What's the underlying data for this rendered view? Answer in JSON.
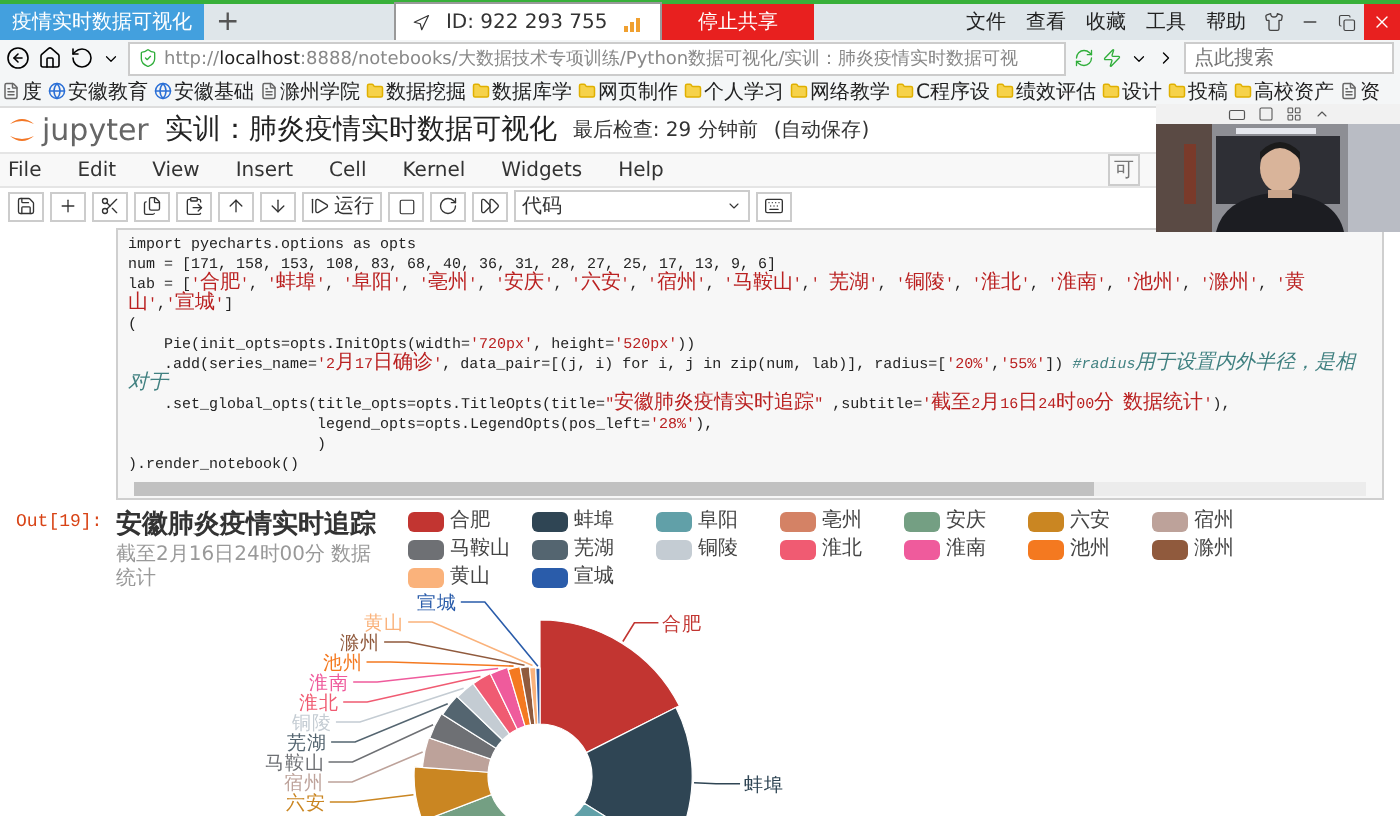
{
  "browser": {
    "tab": {
      "title": "疫情实时数据可视化",
      "selected": true
    },
    "new_tab": "+",
    "share": {
      "id": "ID: 922 293 755",
      "stop": "停止共享"
    },
    "menu": [
      "文件",
      "查看",
      "收藏",
      "工具",
      "帮助"
    ],
    "address": "http://**localhost**:8888/notebooks/大数据技术专项训练/Python数据可视化/实训：肺炎疫情实时数据可视",
    "search": {
      "placeholder": "点此搜索"
    },
    "bookmarks": [
      {
        "label": "度",
        "kind": "page"
      },
      {
        "label": "安徽教育",
        "kind": "site"
      },
      {
        "label": "安徽基础",
        "kind": "site"
      },
      {
        "label": "滁州学院",
        "kind": "page"
      },
      {
        "label": "数据挖掘",
        "kind": "folder"
      },
      {
        "label": "数据库学",
        "kind": "folder"
      },
      {
        "label": "网页制作",
        "kind": "folder"
      },
      {
        "label": "个人学习",
        "kind": "folder"
      },
      {
        "label": "网络教学",
        "kind": "folder"
      },
      {
        "label": "C程序设",
        "kind": "folder"
      },
      {
        "label": "绩效评估",
        "kind": "folder"
      },
      {
        "label": "设计",
        "kind": "folder"
      },
      {
        "label": "投稿",
        "kind": "folder"
      },
      {
        "label": "高校资产",
        "kind": "folder"
      },
      {
        "label": "资",
        "kind": "page"
      }
    ]
  },
  "notebook": {
    "logo": "jupyter",
    "title": "实训：肺炎疫情实时数据可视化",
    "checkpoint": "最后检查: 29 分钟前",
    "autosave": "(自动保存)",
    "menu": [
      "File",
      "Edit",
      "View",
      "Insert",
      "Cell",
      "Kernel",
      "Widgets",
      "Help"
    ],
    "trusted": "可",
    "toolbar": {
      "run": "运行",
      "cell_type": "代码"
    },
    "cell": {
      "code": [
        "import pyecharts.options as opts",
        "num = [171, 158, 153, 108, 83, 68, 40, 36, 31, 28, 27, 25, 17, 13, 9, 6]",
        "lab = ['合肥', '蚌埠', '阜阳', '亳州', '安庆', '六安', '宿州', '马鞍山',' 芜湖', '铜陵', '淮北', '淮南', '池州', '滁州', '黄山','宣城']",
        "(",
        "    Pie(init_opts=opts.InitOpts(width='720px', height='520px'))",
        "    .add(series_name='2月17日确诊', data_pair=[(j, i) for i, j in zip(num, lab)], radius=['20%','55%']) #radius用于设置内外半径，是相对于",
        "    .set_global_opts(title_opts=opts.TitleOpts(title=\"安徽肺炎疫情实时追踪\" ,subtitle='截至2月16日24时00分 数据统计'),",
        "                     legend_opts=opts.LegendOpts(pos_left='28%'),",
        "                     )",
        ").render_notebook()"
      ],
      "output": {
        "prompt": "Out[19]:",
        "title": "安徽肺炎疫情实时追踪",
        "subtitle": "截至2月16日24时00分 数据统计",
        "legend": [
          {
            "label": "合肥",
            "color": "#c23531"
          },
          {
            "label": "蚌埠",
            "color": "#2f4554"
          },
          {
            "label": "阜阳",
            "color": "#61a0a8"
          },
          {
            "label": "亳州",
            "color": "#d48265"
          },
          {
            "label": "安庆",
            "color": "#749f83"
          },
          {
            "label": "六安",
            "color": "#ca8622"
          },
          {
            "label": "宿州",
            "color": "#bda29a"
          },
          {
            "label": "马鞍山",
            "color": "#6e7074"
          },
          {
            "label": "芜湖",
            "color": "#546570"
          },
          {
            "label": "铜陵",
            "color": "#c4ccd3"
          },
          {
            "label": "淮北",
            "color": "#f05b72"
          },
          {
            "label": "淮南",
            "color": "#ef5b9c"
          },
          {
            "label": "池州",
            "color": "#f47920"
          },
          {
            "label": "滁州",
            "color": "#905a3d"
          },
          {
            "label": "黄山",
            "color": "#fab27b"
          },
          {
            "label": "宣城",
            "color": "#2a5caa"
          }
        ],
        "slice_labels": [
          {
            "label": "宣城",
            "color": "#2a5caa"
          },
          {
            "label": "黄山",
            "color": "#fab27b"
          },
          {
            "label": "合肥",
            "color": "#c23531"
          },
          {
            "label": "滁州",
            "color": "#905a3d"
          },
          {
            "label": "池州",
            "color": "#f47920"
          },
          {
            "label": "淮南",
            "color": "#ef5b9c"
          },
          {
            "label": "淮北",
            "color": "#f05b72"
          },
          {
            "label": "铜陵",
            "color": "#c4ccd3"
          },
          {
            "label": "芜湖",
            "color": "#546570"
          },
          {
            "label": "马鞍山",
            "color": "#6e7074"
          },
          {
            "label": "宿州",
            "color": "#bda29a"
          },
          {
            "label": "蚌埠",
            "color": "#2f4554"
          },
          {
            "label": "六安",
            "color": "#ca8622"
          }
        ]
      }
    }
  }
}
